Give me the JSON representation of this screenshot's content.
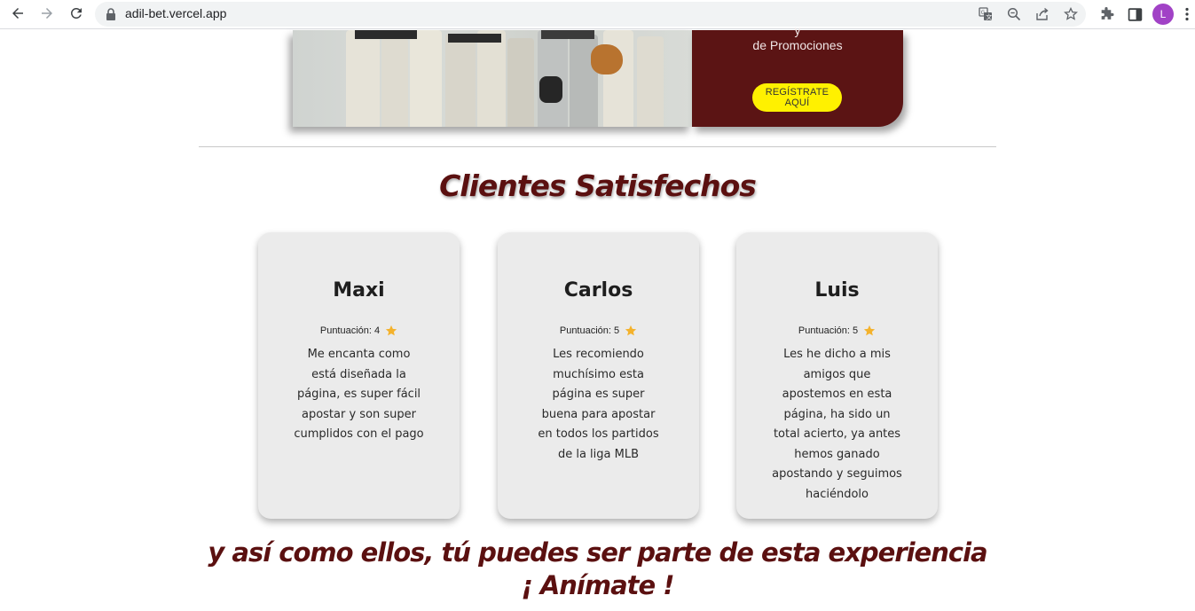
{
  "browser": {
    "url": "adil-bet.vercel.app",
    "avatar_letter": "L",
    "avatar_color": "#a142c6"
  },
  "hero": {
    "panel_text_top": "y",
    "panel_text": "de Promociones",
    "register_label": "REGÍSTRATE AQUÍ",
    "panel_color": "#5b1414",
    "button_color": "#fff100"
  },
  "section": {
    "title": "Clientes Satisfechos",
    "title_color": "#5b1010"
  },
  "testimonials": [
    {
      "name": "Maxi",
      "rating_label": "Puntuación: 4",
      "rating": 4,
      "comment": "Me encanta como está diseñada la página, es super fácil apostar y son super cumplidos con el pago"
    },
    {
      "name": "Carlos",
      "rating_label": "Puntuación: 5",
      "rating": 5,
      "comment": "Les recomiendo muchísimo esta página es super buena para apostar en todos los partidos de la liga MLB"
    },
    {
      "name": "Luis",
      "rating_label": "Puntuación: 5",
      "rating": 5,
      "comment": "Les he dicho a mis amigos que apostemos en esta página, ha sido un total acierto, ya antes hemos ganado apostando y seguimos haciéndolo"
    }
  ],
  "closing": {
    "line1": "y así como ellos, tú puedes ser parte de esta experiencia",
    "line2": "¡ Anímate !"
  },
  "icons": {
    "star_color": "#f4b22c"
  }
}
